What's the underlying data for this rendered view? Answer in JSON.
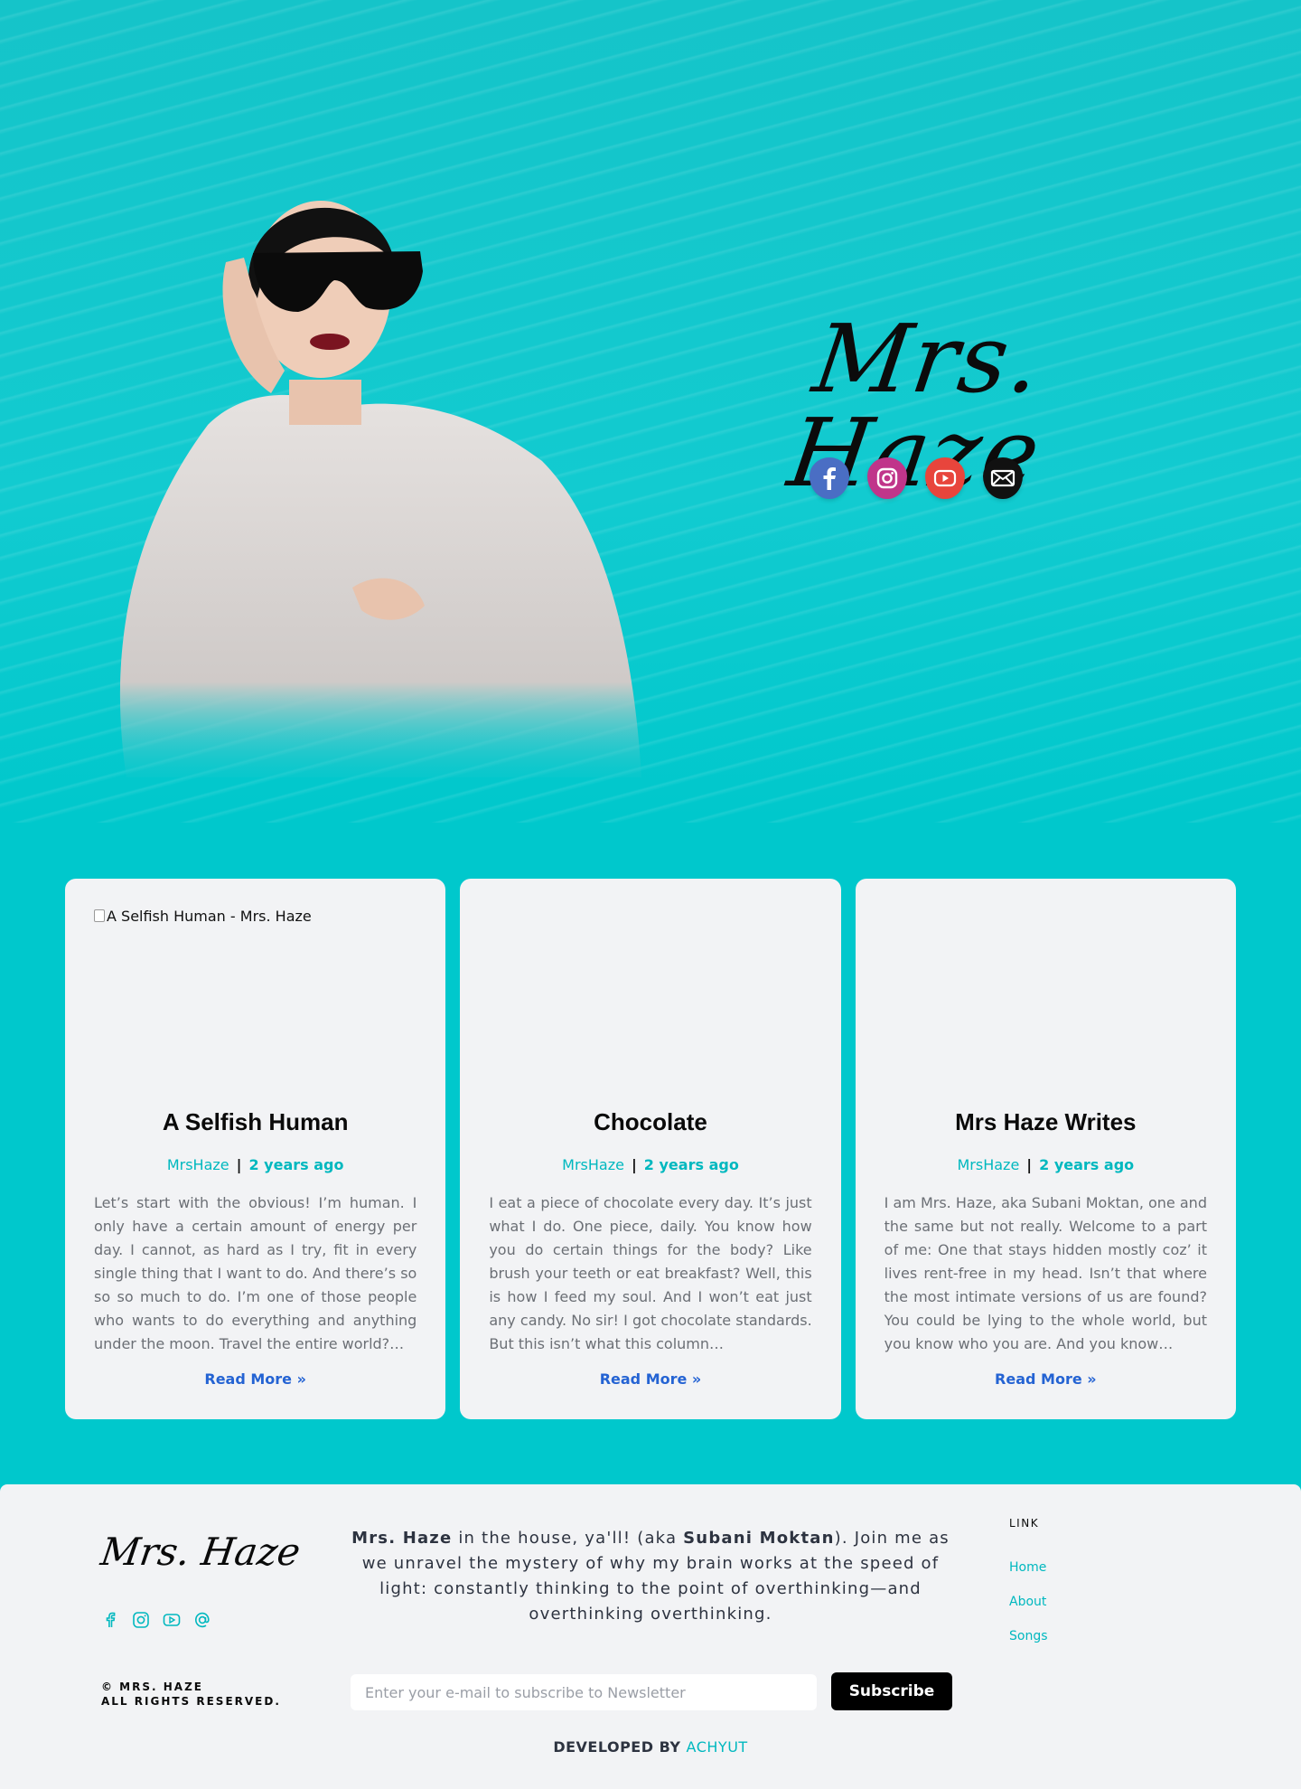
{
  "hero": {
    "title": "Mrs. Haze",
    "social": [
      {
        "icon": "facebook-icon",
        "color": "#4a6ec4"
      },
      {
        "icon": "instagram-icon",
        "color": "#c0358a"
      },
      {
        "icon": "youtube-icon",
        "color": "#e8453c"
      },
      {
        "icon": "mail-icon",
        "color": "#111111"
      }
    ]
  },
  "posts": [
    {
      "image_alt": "A Selfish Human  - Mrs. Haze",
      "title": "A Selfish Human",
      "author": "MrsHaze",
      "date": "2 years ago",
      "excerpt": "Let’s start with the obvious! I’m human. I only have a certain amount of energy per day. I cannot, as hard as I try, fit in every single thing that I want to do. And there’s so so so much to do. I’m one of those people who wants to do everything and anything under the moon. Travel the entire world?…",
      "read_more": "Read More »"
    },
    {
      "image_alt": "",
      "title": "Chocolate",
      "author": "MrsHaze",
      "date": "2 years ago",
      "excerpt": "I eat a piece of chocolate every day. It’s just what I do. One piece, daily. You know how you do certain things for the body? Like brush your teeth or eat breakfast? Well, this is how I feed my soul. And I won’t eat just any candy. No sir! I got chocolate standards. But this isn’t what this column…",
      "read_more": "Read More »"
    },
    {
      "image_alt": "",
      "title": "Mrs Haze Writes",
      "author": "MrsHaze",
      "date": "2 years ago",
      "excerpt": "I am Mrs. Haze, aka Subani Moktan, one and the same but not really. Welcome to a part of me: One that stays hidden mostly coz’ it lives rent-free in my head. Isn’t that where the most intimate versions of us are found? You could be lying to the whole world, but you know who you are. And you know…",
      "read_more": "Read More »"
    }
  ],
  "meta_separator": "|",
  "footer": {
    "logo": "Mrs. Haze",
    "about_name": "Mrs. Haze",
    "about_mid": " in the house, ya'll! (aka ",
    "about_aka": "Subani Moktan",
    "about_rest": "). Join me as we unravel the mystery of why my brain works at the speed of light: constantly thinking to the point of overthinking—and overthinking overthinking.",
    "links_heading": "LINK",
    "links": [
      "Home",
      "About",
      "Songs"
    ],
    "copyright_line1": "© MRS. HAZE",
    "copyright_line2": "ALL RIGHTS RESERVED.",
    "newsletter_placeholder": "Enter your e-mail to subscribe to Newsletter",
    "subscribe_label": "Subscribe",
    "developed_by": "DEVELOPED BY ",
    "developer": "ACHYUT",
    "accent": "#00c8cc"
  }
}
